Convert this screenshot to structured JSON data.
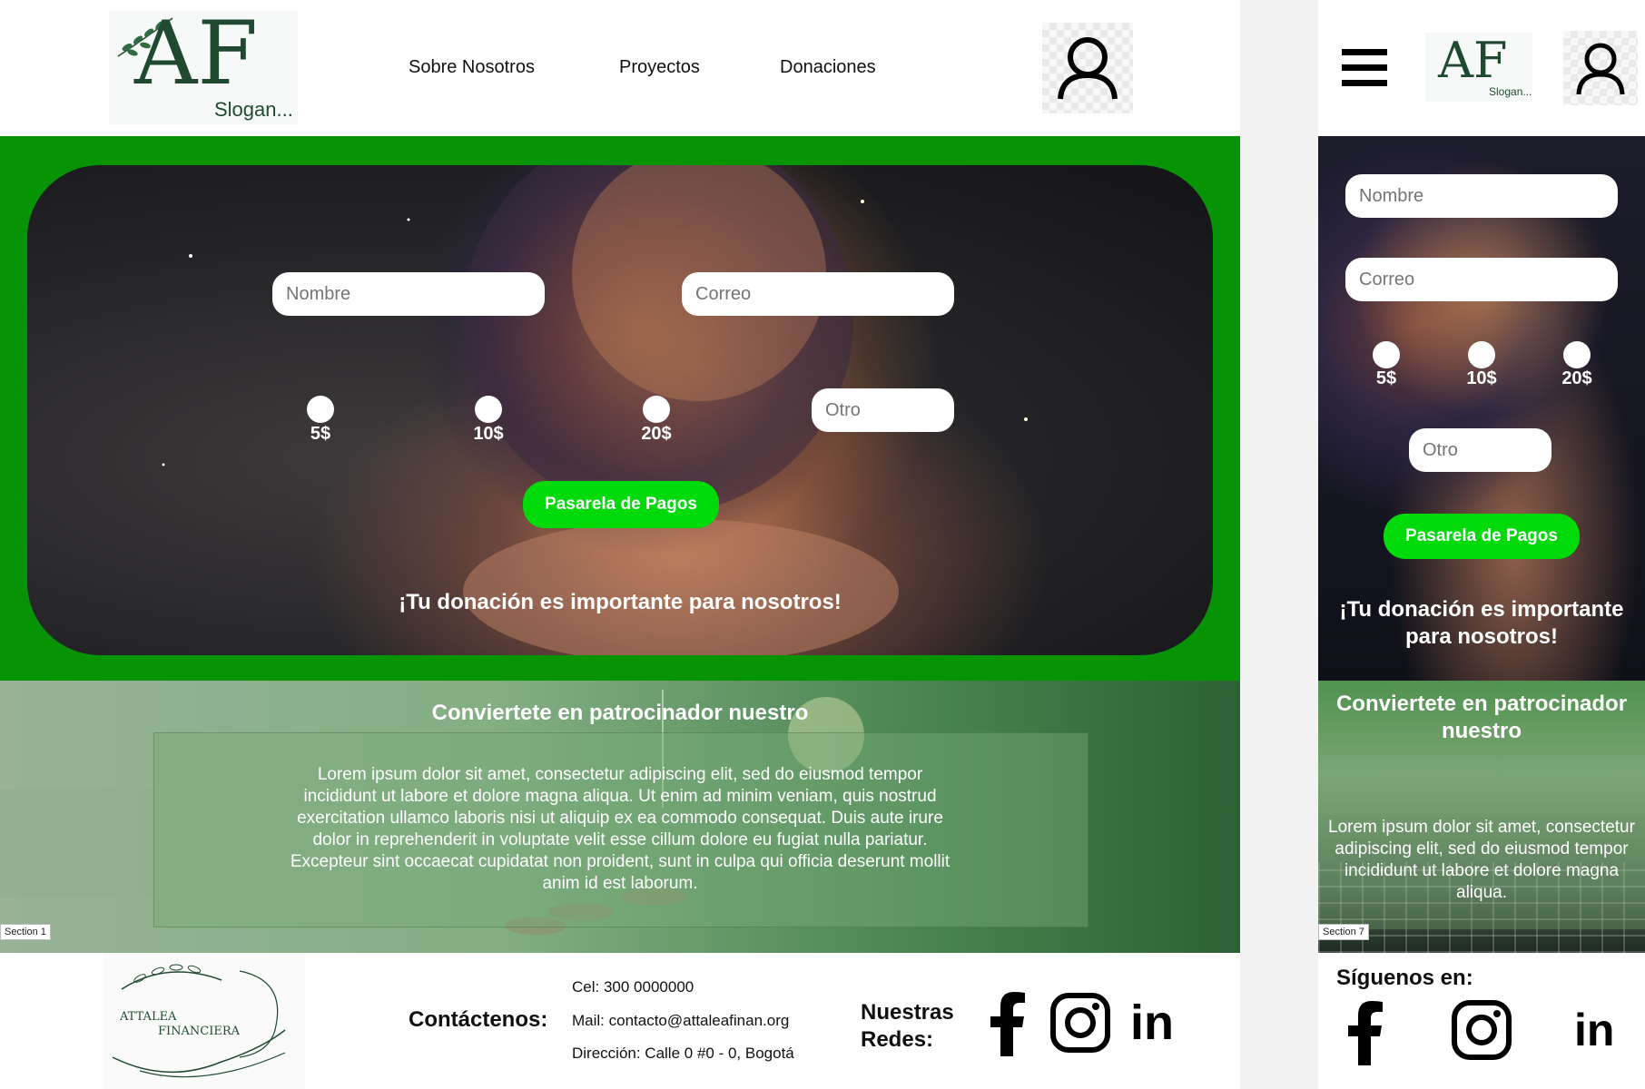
{
  "desktop": {
    "header": {
      "logo_letters": "AF",
      "slogan": "Slogan...",
      "nav": [
        "Sobre Nosotros",
        "Proyectos",
        "Donaciones"
      ]
    },
    "donation": {
      "name_placeholder": "Nombre",
      "email_placeholder": "Correo",
      "amounts": [
        "5$",
        "10$",
        "20$"
      ],
      "other_placeholder": "Otro",
      "pay_button": "Pasarela de Pagos",
      "message": "¡Tu donación es importante para nosotros!"
    },
    "sponsor": {
      "title": "Conviertete en patrocinador nuestro",
      "body": "Lorem ipsum dolor sit amet, consectetur adipiscing elit, sed do eiusmod tempor incididunt ut labore et dolore magna aliqua. Ut enim ad minim veniam, quis nostrud exercitation ullamco laboris nisi ut aliquip ex ea commodo consequat. Duis aute irure dolor in reprehenderit in voluptate velit esse cillum dolore eu fugiat nulla pariatur. Excepteur sint occaecat cupidatat non proident, sunt in culpa qui officia deserunt mollit anim id est laborum.",
      "section_tag": "Section 1"
    },
    "footer": {
      "logo_text_1": "ATTALEA",
      "logo_text_2": "FINANCIERA",
      "contact_label": "Contáctenos:",
      "phone": "Cel: 300 0000000",
      "mail": "Mail: contacto@attaleafinan.org",
      "address": "Dirección: Calle 0 #0 - 0, Bogotá",
      "social_label_1": "Nuestras",
      "social_label_2": "Redes:",
      "linkedin_text": "in"
    }
  },
  "mobile": {
    "header": {
      "logo_letters": "AF",
      "slogan": "Slogan..."
    },
    "donation": {
      "name_placeholder": "Nombre",
      "email_placeholder": "Correo",
      "amounts": [
        "5$",
        "10$",
        "20$"
      ],
      "other_placeholder": "Otro",
      "pay_button": "Pasarela de Pagos",
      "message_line1": "¡Tu donación es importante",
      "message_line2": "para nosotros!"
    },
    "sponsor": {
      "title_line1": "Conviertete en patrocinador",
      "title_line2": "nuestro",
      "body": "Lorem ipsum dolor sit amet, consectetur adipiscing elit, sed do eiusmod tempor incididunt ut labore et dolore magna aliqua.",
      "section_tag": "Section 7"
    },
    "footer": {
      "follow_label": "Síguenos en:",
      "linkedin_text": "in"
    }
  },
  "colors": {
    "brand_green": "#069306",
    "button_green": "#00d90a",
    "logo_green": "#1f4a30"
  }
}
